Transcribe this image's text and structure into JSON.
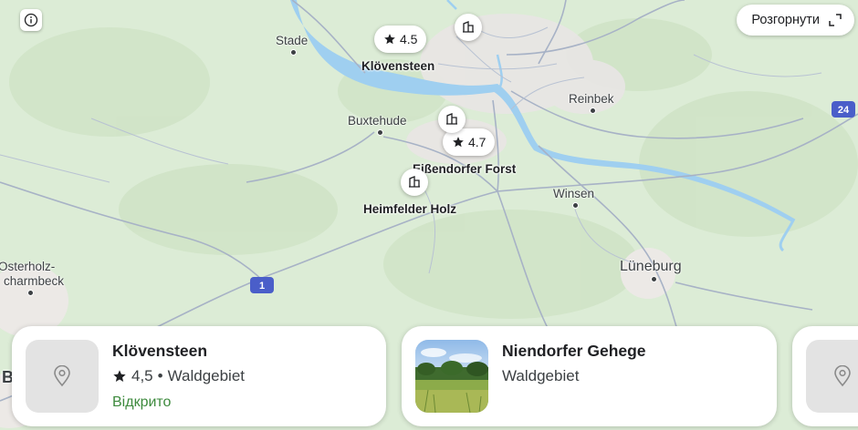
{
  "controls": {
    "info_icon": "info-icon",
    "expand_label": "Розгорнути",
    "expand_icon": "expand-icon"
  },
  "pins": {
    "rating_1": "4.5",
    "rating_2": "4.7"
  },
  "place_labels": {
    "klovensteen": "Klövensteen",
    "eissendorfer": "Eißendorfer Forst",
    "heimfelder": "Heimfelder Holz"
  },
  "cities": {
    "stade": "Stade",
    "buxtehude": "Buxtehude",
    "reinbek": "Reinbek",
    "winsen": "Winsen",
    "luneburg": "Lüneburg",
    "osterholz_1": "Osterholz-",
    "osterholz_2": "charmbeck",
    "edge_b": "B"
  },
  "road_shields": {
    "a1": "1",
    "a24": "24"
  },
  "colors": {
    "forest_green": "#cfe5c6",
    "water": "#9fcff0",
    "road": "#9aa8be",
    "highway_shield": "#4a5ec9",
    "status_open": "#3d8a3d"
  },
  "cards": [
    {
      "title": "Klövensteen",
      "rating": "4,5",
      "separator": "•",
      "type": "Waldgebiet",
      "status": "Відкрито",
      "thumb_icon": "map-pin-icon"
    },
    {
      "title": "Niendorfer Gehege",
      "type": "Waldgebiet",
      "thumb_icon": "forest-photo"
    },
    {
      "thumb_icon": "map-pin-icon"
    }
  ]
}
